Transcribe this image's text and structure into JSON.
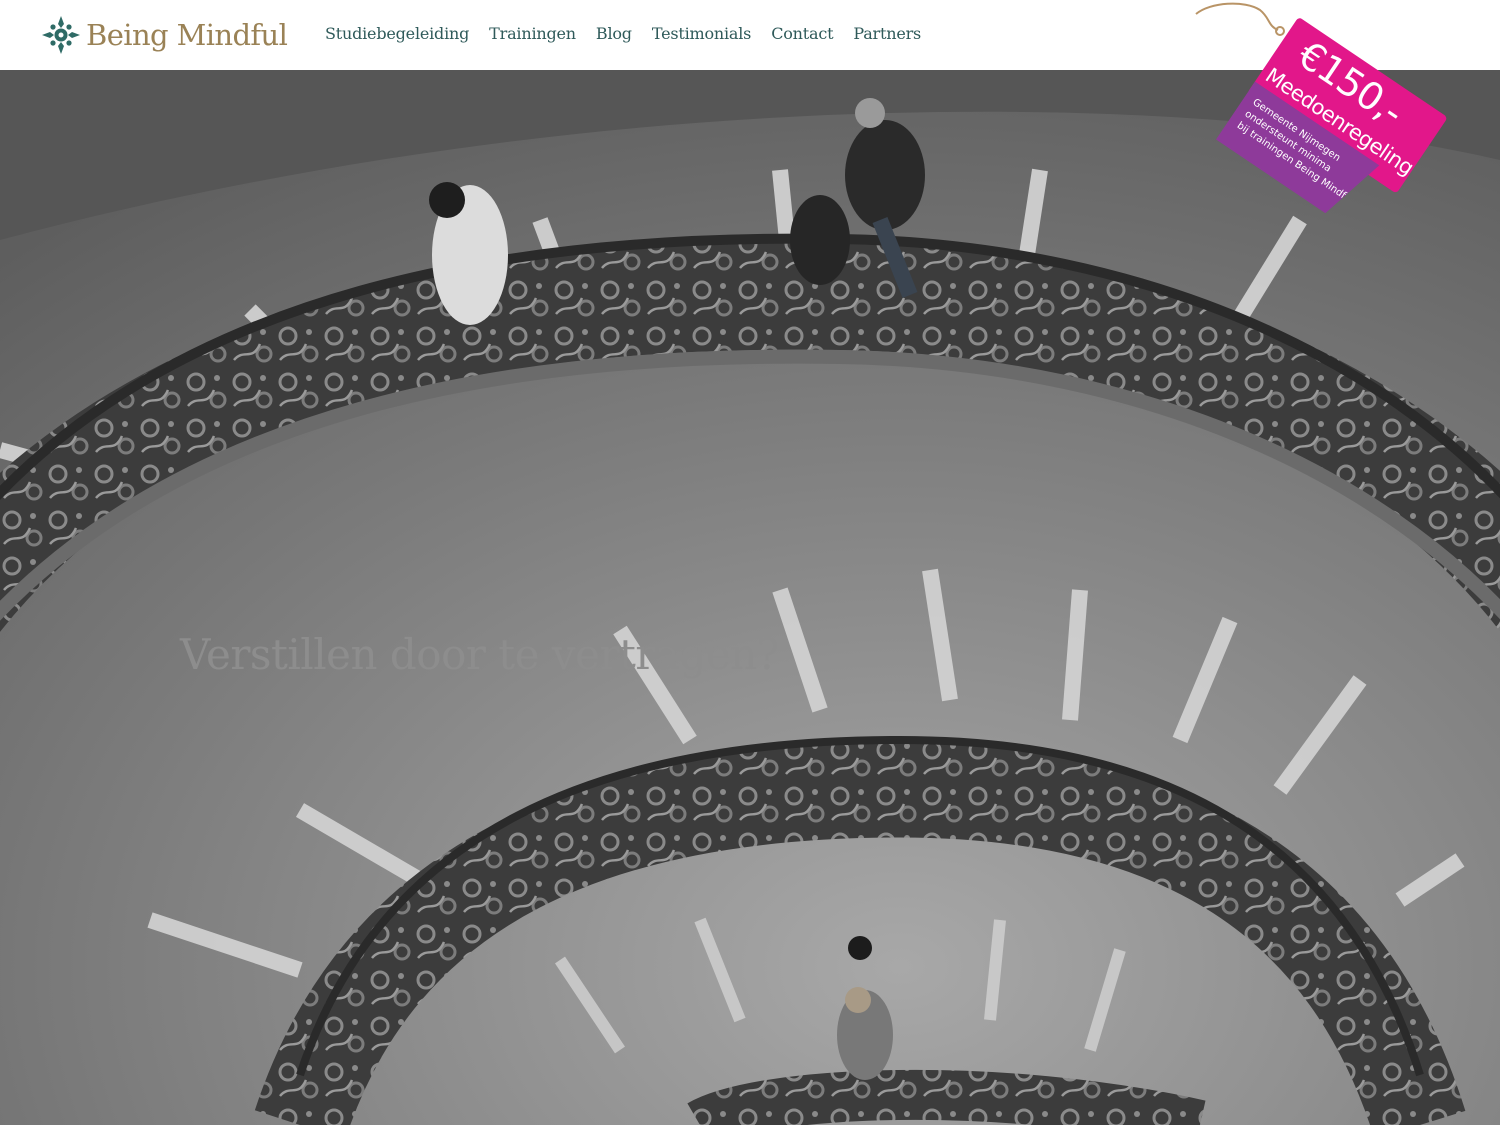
{
  "brand": {
    "name": "Being Mindful",
    "logo_icon": "ornamental-cross-icon",
    "accent_color": "#9a8256",
    "nav_color": "#2f5a5a"
  },
  "nav": {
    "items": [
      {
        "label": "Studiebegeleiding"
      },
      {
        "label": "Trainingen"
      },
      {
        "label": "Blog"
      },
      {
        "label": "Testimonials"
      },
      {
        "label": "Contact"
      },
      {
        "label": "Partners"
      }
    ]
  },
  "promo": {
    "price": "€150,-",
    "name": "Meedoenregeling",
    "line1": "Gemeente Nijmegen",
    "line2": "ondersteunt minima",
    "line3": "bij trainingen Being Mindful",
    "colors": {
      "primary": "#e2178a",
      "secondary": "#8e3a9a"
    }
  },
  "hero": {
    "heading": "Verstillen door te vertragen?",
    "image_description_icon": "spiral-staircase-photo"
  }
}
